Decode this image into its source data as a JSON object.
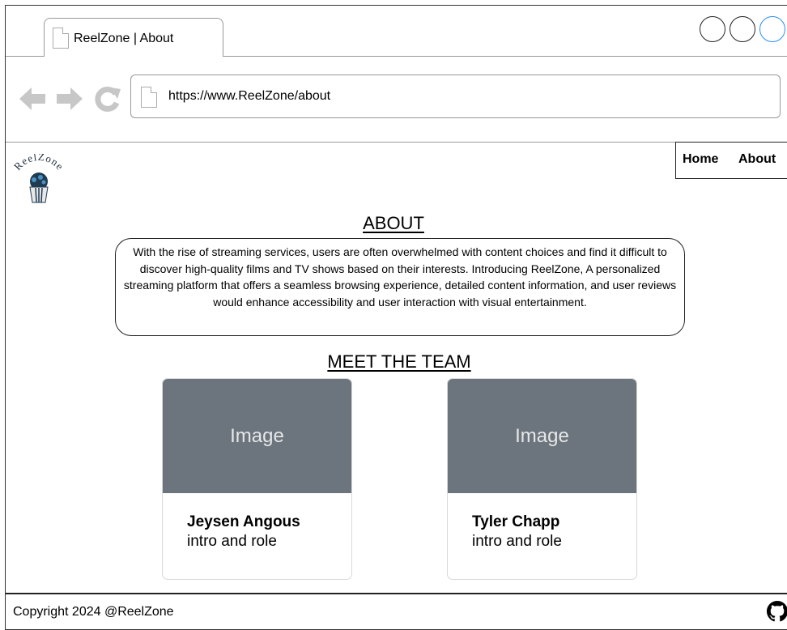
{
  "browser": {
    "tab_title": "ReelZone | About",
    "url": "https://www.ReelZone/about",
    "icons": [
      "back-arrow-icon",
      "forward-arrow-icon",
      "refresh-icon",
      "document-icon"
    ]
  },
  "site": {
    "logo_text": "ReelZone",
    "nav": {
      "home": "Home",
      "about": "About"
    }
  },
  "about": {
    "heading": "ABOUT",
    "text": "With the rise of streaming services, users are often overwhelmed with content choices and find it difficult to discover high-quality films and TV shows based on their interests. Introducing ReelZone, A personalized streaming platform that offers a seamless browsing experience, detailed content information, and user reviews would enhance accessibility and user interaction with visual entertainment."
  },
  "team": {
    "heading": "MEET THE TEAM",
    "members": [
      {
        "image_label": "Image",
        "name": "Jeysen Angous",
        "role": "intro and role"
      },
      {
        "image_label": "Image",
        "name": "Tyler Chapp",
        "role": "intro and role"
      }
    ]
  },
  "footer": {
    "copyright": "Copyright 2024 @ReelZone",
    "icon": "github-icon"
  },
  "colors": {
    "card_image_bg": "#6c757d",
    "window_button_accent": "#2c8ef0"
  }
}
